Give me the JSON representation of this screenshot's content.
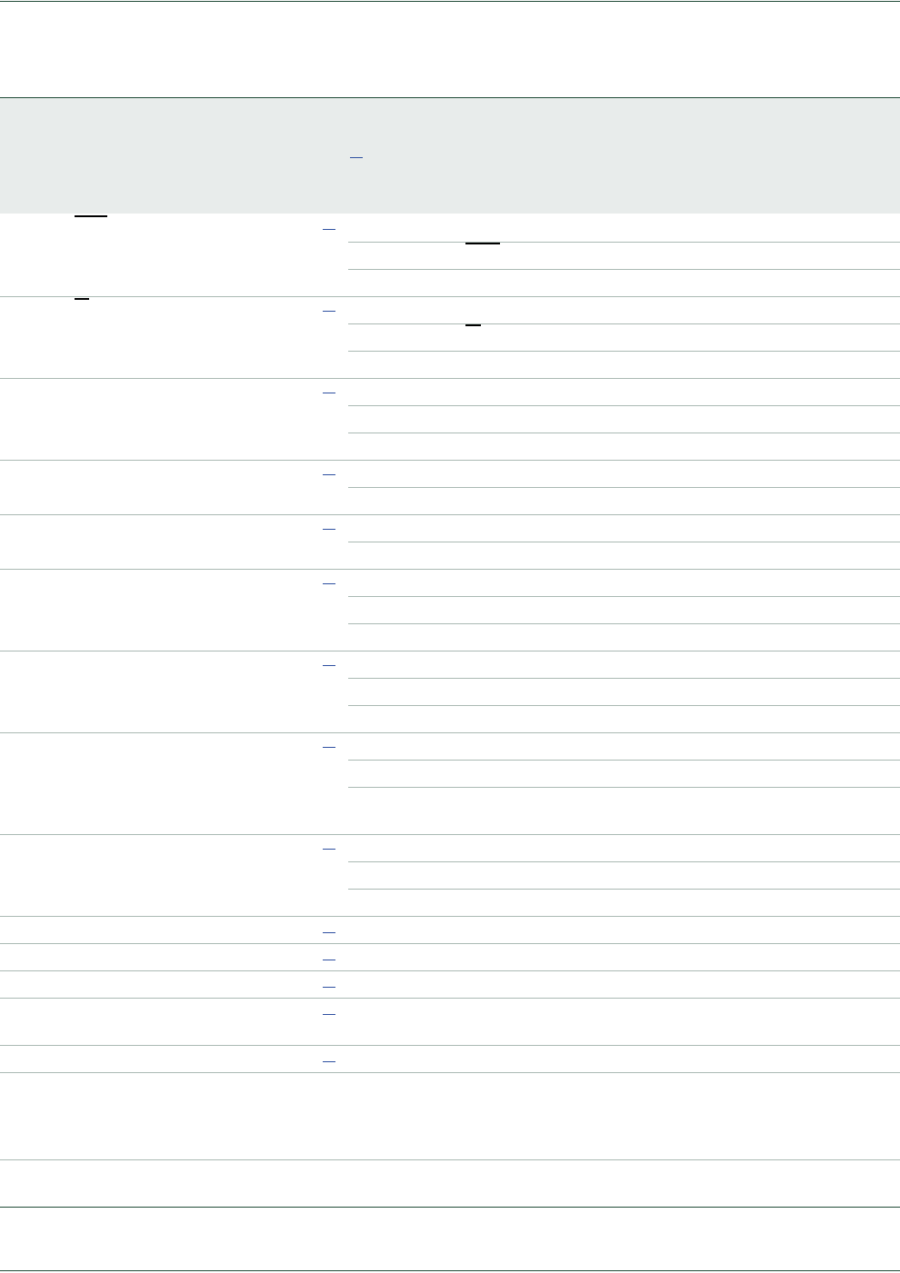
{
  "document": {
    "page_header": {},
    "table": {
      "header_row": {},
      "rows": [
        {
          "sub_rows": 3
        },
        {
          "sub_rows": 3
        },
        {
          "sub_rows": 3
        },
        {
          "sub_rows": 2
        },
        {
          "sub_rows": 2
        },
        {
          "sub_rows": 3
        },
        {
          "sub_rows": 3
        },
        {
          "sub_rows": 3
        },
        {
          "sub_rows": 3
        },
        {
          "sub_rows": 1
        },
        {
          "sub_rows": 1
        },
        {
          "sub_rows": 1
        },
        {
          "sub_rows": 1
        },
        {
          "sub_rows": 1
        },
        {
          "sub_rows": 1
        },
        {
          "sub_rows": 1
        }
      ]
    },
    "footer": {},
    "colors": {
      "rule_dark": "#1f4a36",
      "rule_light": "#aab9b3",
      "header_band": "#e8eceb",
      "reference_link": "#2d4fa0"
    }
  }
}
